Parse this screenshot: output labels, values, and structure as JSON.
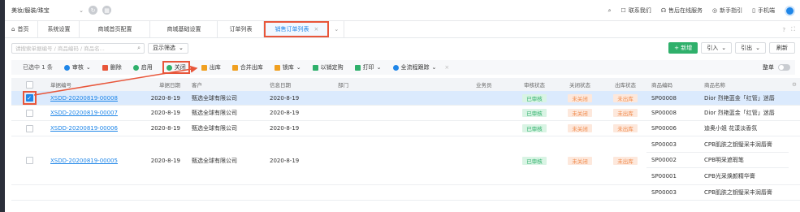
{
  "top": {
    "store": "美妆/服装/珠宝",
    "links": [
      "联系我们",
      "售后在线服务",
      "新手指引",
      "手机端"
    ]
  },
  "tabs": {
    "home": "首页",
    "items": [
      "系统设置",
      "商城首页配置",
      "商城基础设置",
      "订单列表"
    ],
    "active": "销售订单列表",
    "close": "×"
  },
  "search": {
    "placeholder": "请搜索单据编号 / 商品编码 / 商品名...",
    "filter_label": "显示筛选"
  },
  "right_buttons": {
    "new": "+ 新增",
    "import": "引入",
    "export": "引出",
    "refresh": "刷新"
  },
  "toolbar": {
    "selected": "已选中 1 条",
    "actions": [
      {
        "label": "审核",
        "color": "#1f86e8",
        "caret": true
      },
      {
        "label": "删除",
        "color": "#e8563a",
        "caret": false
      },
      {
        "label": "启用",
        "color": "#2fb06b",
        "caret": false
      },
      {
        "label": "关闭",
        "color": "#2fb06b",
        "caret": false
      },
      {
        "label": "出库",
        "color": "#f0a020",
        "caret": false
      },
      {
        "label": "合并出库",
        "color": "#f0a020",
        "caret": false
      },
      {
        "label": "锁库",
        "color": "#f0a020",
        "caret": true
      },
      {
        "label": "以销定购",
        "color": "#2fb06b",
        "caret": false
      },
      {
        "label": "打印",
        "color": "#2fb06b",
        "caret": true
      },
      {
        "label": "全流程跟踪",
        "color": "#1f86e8",
        "caret": true
      }
    ],
    "toggle_label": "整单"
  },
  "table": {
    "headers": [
      "单据编号",
      "单据日期",
      "客户",
      "信息日期",
      "部门",
      "业务员",
      "审核状态",
      "关闭状态",
      "出库状态",
      "商品编码",
      "商品名称"
    ],
    "rows": [
      {
        "no": "XSDD-20200819-00008",
        "date": "2020-8-19",
        "customer": "甄选全球有限公司",
        "info_date": "2020-8-19",
        "audit": "已审核",
        "close": "未关闭",
        "out": "未出库",
        "items": [
          {
            "code": "SP00008",
            "name": "Dior 烈艳蓝金「红管」迷唇"
          }
        ],
        "selected": true
      },
      {
        "no": "XSDD-20200819-00007",
        "date": "2020-8-19",
        "customer": "甄选全球有限公司",
        "info_date": "2020-8-19",
        "audit": "已审核",
        "close": "未关闭",
        "out": "未出库",
        "items": [
          {
            "code": "SP00008",
            "name": "Dior 烈艳蓝金「红管」迷唇"
          }
        ],
        "selected": false
      },
      {
        "no": "XSDD-20200819-00006",
        "date": "2020-8-19",
        "customer": "甄选全球有限公司",
        "info_date": "2020-8-19",
        "audit": "已审核",
        "close": "未关闭",
        "out": "未出库",
        "items": [
          {
            "code": "SP00006",
            "name": "迪奥小姐 花漾淡香氛"
          }
        ],
        "selected": false
      },
      {
        "no": "XSDD-20200819-00005",
        "date": "2020-8-19",
        "customer": "甄选全球有限公司",
        "info_date": "2020-8-19",
        "audit": "已审核",
        "close": "未关闭",
        "out": "未出库",
        "items": [
          {
            "code": "SP00003",
            "name": "CPB肌肤之钥璧采丰润唇膏"
          },
          {
            "code": "SP00002",
            "name": "CPB明采遮瑕笔"
          },
          {
            "code": "SP00001",
            "name": "CPB光采焕颜精华膏"
          }
        ],
        "selected": false
      },
      {
        "no": "",
        "date": "",
        "customer": "",
        "info_date": "",
        "audit": "",
        "close": "",
        "out": "",
        "items": [
          {
            "code": "SP00003",
            "name": "CPB肌肤之钥璧采丰润唇膏"
          }
        ],
        "selected": false
      }
    ]
  }
}
